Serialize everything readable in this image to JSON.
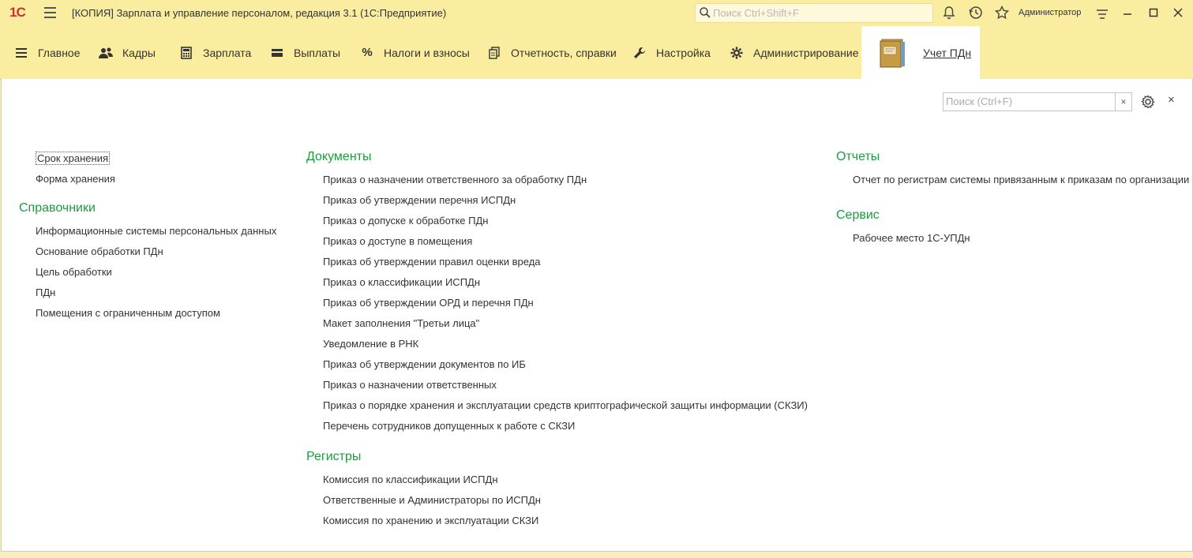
{
  "titlebar": {
    "logo": "1С",
    "title": "[КОПИЯ] Зарплата и управление персоналом, редакция 3.1  (1С:Предприятие)",
    "search_placeholder": "Поиск Ctrl+Shift+F",
    "user": "Администратор"
  },
  "menu": {
    "items": [
      {
        "label": "Главное",
        "icon": "list-icon"
      },
      {
        "label": "Кадры",
        "icon": "people-icon"
      },
      {
        "label": "Зарплата",
        "icon": "calculator-icon"
      },
      {
        "label": "Выплаты",
        "icon": "wallet-icon"
      },
      {
        "label": "Налоги и взносы",
        "icon": "percent-icon"
      },
      {
        "label": "Отчетность, справки",
        "icon": "reports-icon"
      },
      {
        "label": "Настройка",
        "icon": "wrench-icon"
      },
      {
        "label": "Администрирование",
        "icon": "gear-icon"
      },
      {
        "label": "Учет ПДн",
        "icon": "binder-icon"
      }
    ]
  },
  "panel": {
    "search_placeholder": "Поиск (Ctrl+F)",
    "clear_label": "×",
    "close_label": "×"
  },
  "left": {
    "top_links": [
      "Срок хранения",
      "Форма хранения"
    ],
    "references_title": "Справочники",
    "references": [
      "Информационные системы персональных данных",
      "Основание обработки ПДн",
      "Цель обработки",
      "ПДн",
      "Помещения с ограниченным доступом"
    ]
  },
  "middle": {
    "documents_title": "Документы",
    "documents": [
      "Приказ о назначении ответственного за обработку ПДн",
      "Приказ об утверждении перечня ИСПДн",
      "Приказ о допуске к обработке ПДн",
      "Приказ о доступе в помещения",
      "Приказ об утверждении правил оценки вреда",
      "Приказ о классификации ИСПДн",
      "Приказ об утверждении ОРД и перечня ПДн",
      "Макет заполнения \"Третьи лица\"",
      "Уведомление в РНК",
      "Приказ об утверждении документов по ИБ",
      "Приказ о назначении ответственных",
      "Приказ о порядке хранения и эксплуатации средств криптографической защиты информации (СКЗИ)",
      "Перечень сотрудников допущенных к работе с СКЗИ"
    ],
    "registers_title": "Регистры",
    "registers": [
      "Комиссия по классификации ИСПДн",
      "Ответственные и Администраторы по ИСПДн",
      "Комиссия по хранению и эксплуатации СКЗИ"
    ]
  },
  "right": {
    "reports_title": "Отчеты",
    "reports": [
      "Отчет по регистрам системы привязанным к приказам по организации"
    ],
    "service_title": "Сервис",
    "service": [
      "Рабочее место 1С-УПДн"
    ]
  },
  "colors": {
    "accent_green": "#1c9c3f",
    "titlebar_bg": "#fbeda0",
    "logo_red": "#d32d2a"
  }
}
